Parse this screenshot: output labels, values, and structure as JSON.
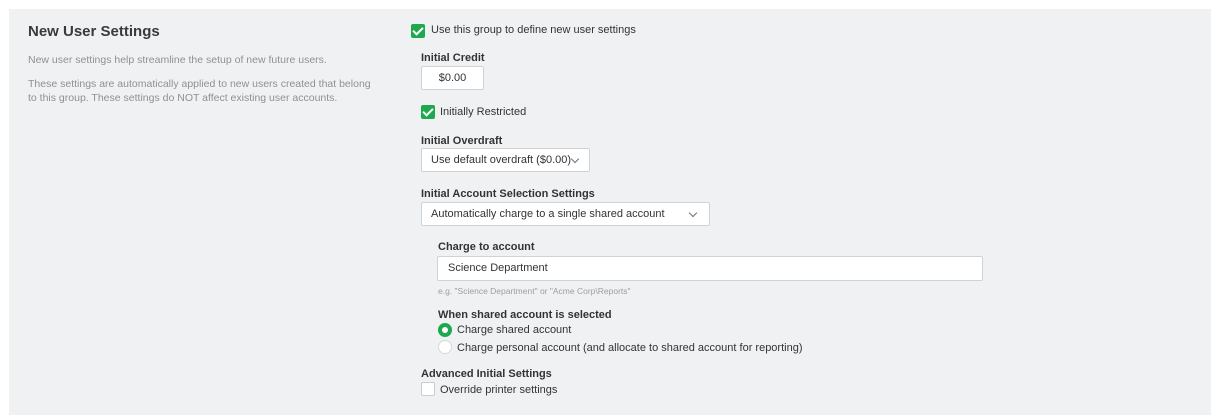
{
  "section": {
    "title": "New User Settings",
    "description_1": "New user settings help streamline the setup of new future users.",
    "description_2": "These settings are automatically applied to new users created that belong to this group. These settings do NOT affect existing user accounts."
  },
  "use_group": {
    "label": "Use this group to define new user settings",
    "checked": true
  },
  "initial_credit": {
    "label": "Initial Credit",
    "value": "$0.00"
  },
  "initially_restricted": {
    "label": "Initially Restricted",
    "checked": true
  },
  "initial_overdraft": {
    "label": "Initial Overdraft",
    "selected": "Use default overdraft ($0.00)"
  },
  "account_selection": {
    "label": "Initial Account Selection Settings",
    "selected": "Automatically charge to a single shared account"
  },
  "charge_to_account": {
    "label": "Charge to account",
    "value": "Science Department",
    "hint": "e.g. \"Science Department\" or \"Acme Corp\\Reports\""
  },
  "shared_selected": {
    "label": "When shared account is selected",
    "options": [
      {
        "label": "Charge shared account",
        "selected": true
      },
      {
        "label": "Charge personal account (and allocate to shared account for reporting)",
        "selected": false
      }
    ]
  },
  "advanced": {
    "label": "Advanced Initial Settings",
    "override_label": "Override printer settings",
    "override_checked": false
  },
  "colors": {
    "accent": "#1ea94f",
    "panel_bg": "#f0f1f3"
  },
  "icons": {
    "checkbox": "check-icon",
    "dropdown": "chevron-down-icon"
  }
}
